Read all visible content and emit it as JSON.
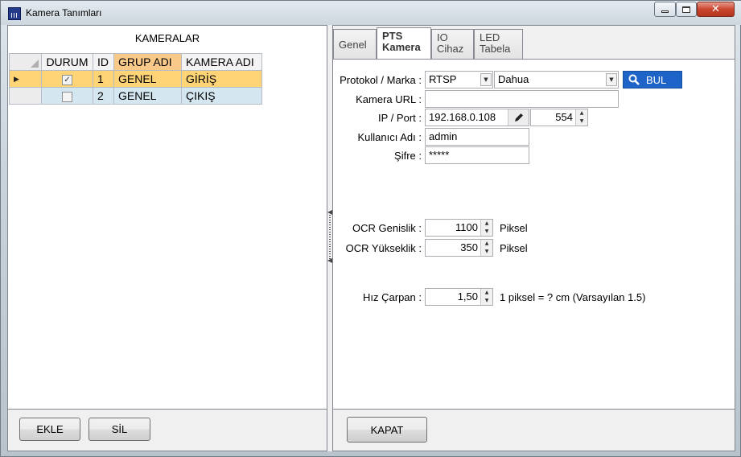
{
  "window": {
    "title": "Kamera Tanımları",
    "buttons": {
      "minimize": "minimize",
      "maximize": "maximize",
      "close": "close"
    }
  },
  "left": {
    "title": "KAMERALAR",
    "grid": {
      "headers": [
        "DURUM",
        "ID",
        "GRUP  ADI",
        "KAMERA  ADI"
      ],
      "rows": [
        {
          "durum": "✓",
          "id": "1",
          "grup": "GENEL",
          "kamera": "GİRİŞ",
          "selected": true
        },
        {
          "durum": "",
          "id": "2",
          "grup": "GENEL",
          "kamera": "ÇIKIŞ",
          "selected": false
        }
      ],
      "row_indicator": "▶"
    },
    "buttons": {
      "add": "EKLE",
      "delete": "SİL"
    }
  },
  "right": {
    "tabs": [
      {
        "label": "Genel",
        "active": false
      },
      {
        "label": "PTS Kamera",
        "active": true
      },
      {
        "label": "IO Cihaz",
        "active": false
      },
      {
        "label": "LED Tabela",
        "active": false
      }
    ],
    "form": {
      "protocol_label": "Protokol / Marka :",
      "protocol_value": "RTSP",
      "brand_value": "Dahua",
      "find_button": "BUL",
      "url_label": "Kamera URL :",
      "url_value": "",
      "ip_label": "IP / Port :",
      "ip_value": "192.168.0.108",
      "port_value": "554",
      "user_label": "Kullanıcı Adı :",
      "user_value": "admin",
      "password_label": "Şifre :",
      "password_value": "*****",
      "ocr_width_label": "OCR Genislik :",
      "ocr_width_value": "1100",
      "ocr_height_label": "OCR Yükseklik :",
      "ocr_height_value": "350",
      "pixel_unit": "Piksel",
      "speed_label": "Hız Çarpan :",
      "speed_value": "1,50",
      "speed_hint": "1 piksel = ? cm (Varsayılan 1.5)"
    },
    "close_button": "KAPAT"
  }
}
